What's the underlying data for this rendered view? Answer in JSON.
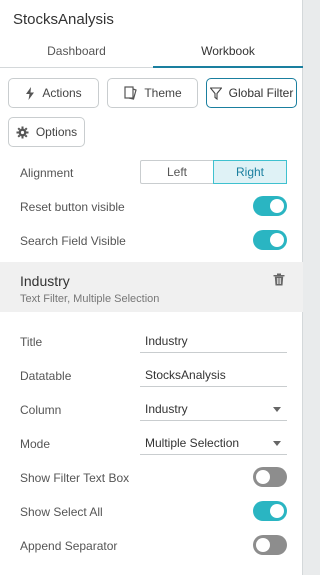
{
  "app": {
    "title": "StocksAnalysis"
  },
  "tabs": [
    {
      "label": "Dashboard"
    },
    {
      "label": "Workbook"
    }
  ],
  "toolbar": {
    "actions_label": "Actions",
    "theme_label": "Theme",
    "global_filter_label": "Global Filter",
    "options_label": "Options"
  },
  "settings": {
    "alignment_label": "Alignment",
    "alignment_options": [
      "Left",
      "Right"
    ],
    "alignment_selected": "Right",
    "reset_button_label": "Reset button visible",
    "reset_button_on": true,
    "search_field_label": "Search Field Visible",
    "search_field_on": true
  },
  "filter": {
    "name": "Industry",
    "subtitle": "Text Filter, Multiple Selection",
    "title_label": "Title",
    "title_value": "Industry",
    "datatable_label": "Datatable",
    "datatable_value": "StocksAnalysis",
    "column_label": "Column",
    "column_value": "Industry",
    "mode_label": "Mode",
    "mode_value": "Multiple Selection",
    "show_filter_text_box_label": "Show Filter Text Box",
    "show_filter_text_box_on": false,
    "show_select_all_label": "Show Select All",
    "show_select_all_on": true,
    "append_separator_label": "Append Separator",
    "append_separator_on": false
  },
  "colors": {
    "accent": "#2ab5c2",
    "toggle_off": "#8d8d8d",
    "tab_underline": "#1a7f9f"
  },
  "icons": {
    "actions": "lightning-icon",
    "theme": "theme-icon",
    "global_filter": "filter-icon",
    "options": "gear-icon",
    "delete": "trash-icon"
  }
}
